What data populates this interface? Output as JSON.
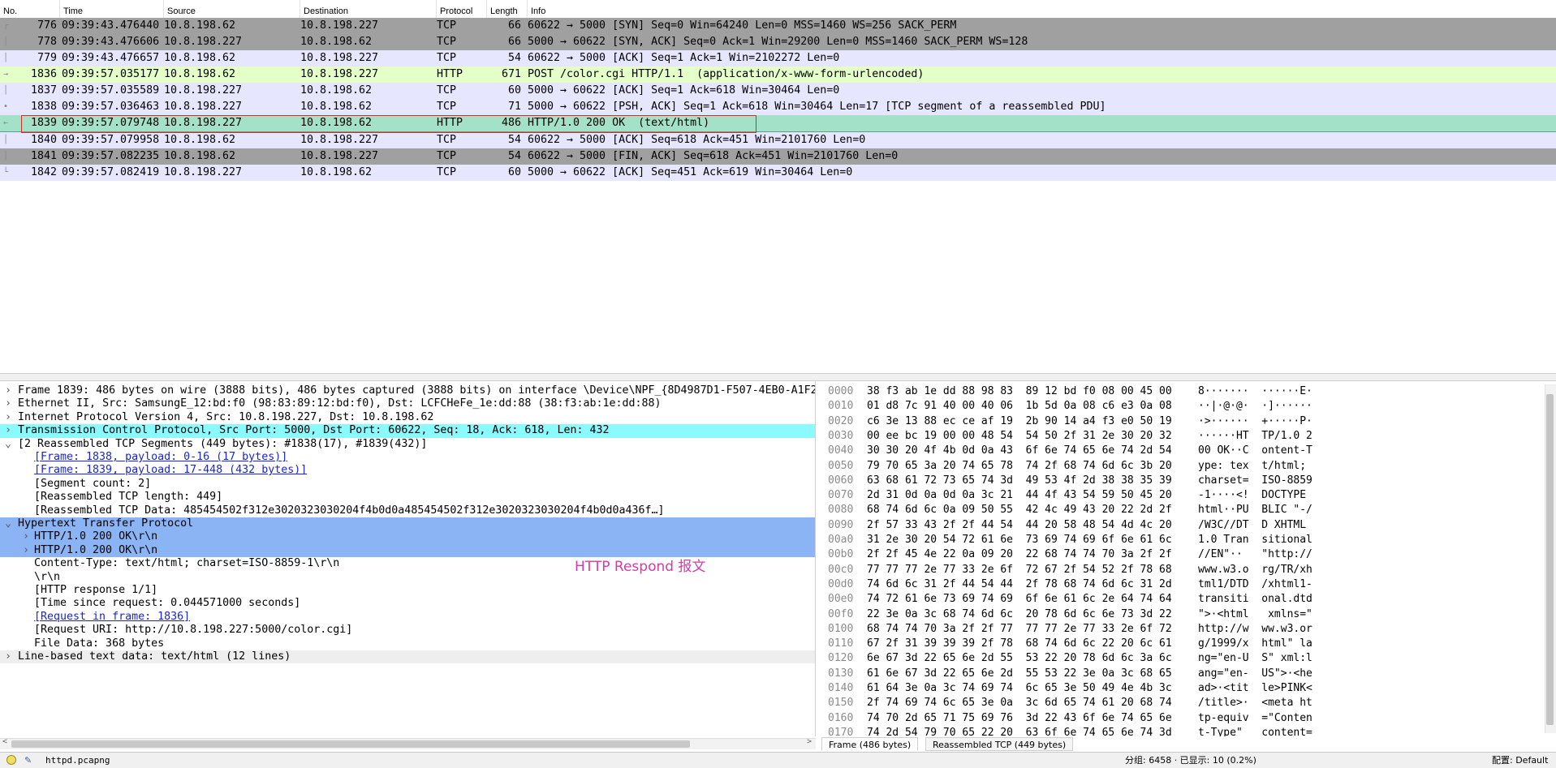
{
  "packet_list": {
    "columns": [
      "No.",
      "Time",
      "Source",
      "Destination",
      "Protocol",
      "Length",
      "Info"
    ],
    "rows": [
      {
        "no": "776",
        "time": "09:39:43.476440",
        "src": "10.8.198.62",
        "dst": "10.8.198.227",
        "proto": "TCP",
        "len": "66",
        "info": "60622 → 5000 [SYN] Seq=0 Win=64240 Len=0 MSS=1460 WS=256 SACK_PERM",
        "bg": "#a0a0a0",
        "rel": "┌"
      },
      {
        "no": "778",
        "time": "09:39:43.476606",
        "src": "10.8.198.227",
        "dst": "10.8.198.62",
        "proto": "TCP",
        "len": "66",
        "info": "5000 → 60622 [SYN, ACK] Seq=0 Ack=1 Win=29200 Len=0 MSS=1460 SACK_PERM WS=128",
        "bg": "#a0a0a0",
        "rel": "│"
      },
      {
        "no": "779",
        "time": "09:39:43.476657",
        "src": "10.8.198.62",
        "dst": "10.8.198.227",
        "proto": "TCP",
        "len": "54",
        "info": "60622 → 5000 [ACK] Seq=1 Ack=1 Win=2102272 Len=0",
        "bg": "#e7e6ff",
        "rel": "│"
      },
      {
        "no": "1836",
        "time": "09:39:57.035177",
        "src": "10.8.198.62",
        "dst": "10.8.198.227",
        "proto": "HTTP",
        "len": "671",
        "info": "POST /color.cgi HTTP/1.1  (application/x-www-form-urlencoded)",
        "bg": "#e4ffc7",
        "rel": "→"
      },
      {
        "no": "1837",
        "time": "09:39:57.035589",
        "src": "10.8.198.227",
        "dst": "10.8.198.62",
        "proto": "TCP",
        "len": "60",
        "info": "5000 → 60622 [ACK] Seq=1 Ack=618 Win=30464 Len=0",
        "bg": "#e7e6ff",
        "rel": "│"
      },
      {
        "no": "1838",
        "time": "09:39:57.036463",
        "src": "10.8.198.227",
        "dst": "10.8.198.62",
        "proto": "TCP",
        "len": "71",
        "info": "5000 → 60622 [PSH, ACK] Seq=1 Ack=618 Win=30464 Len=17 [TCP segment of a reassembled PDU]",
        "bg": "#e7e6ff",
        "rel": "•"
      },
      {
        "no": "1839",
        "time": "09:39:57.079748",
        "src": "10.8.198.227",
        "dst": "10.8.198.62",
        "proto": "HTTP",
        "len": "486",
        "info": "HTTP/1.0 200 OK  (text/html)",
        "bg": "#a3e1c8",
        "rel": "←"
      },
      {
        "no": "1840",
        "time": "09:39:57.079958",
        "src": "10.8.198.62",
        "dst": "10.8.198.227",
        "proto": "TCP",
        "len": "54",
        "info": "60622 → 5000 [ACK] Seq=618 Ack=451 Win=2101760 Len=0",
        "bg": "#e7e6ff",
        "rel": "│"
      },
      {
        "no": "1841",
        "time": "09:39:57.082235",
        "src": "10.8.198.62",
        "dst": "10.8.198.227",
        "proto": "TCP",
        "len": "54",
        "info": "60622 → 5000 [FIN, ACK] Seq=618 Ack=451 Win=2101760 Len=0",
        "bg": "#a0a0a0",
        "rel": "│"
      },
      {
        "no": "1842",
        "time": "09:39:57.082419",
        "src": "10.8.198.227",
        "dst": "10.8.198.62",
        "proto": "TCP",
        "len": "60",
        "info": "5000 → 60622 [ACK] Seq=451 Ack=619 Win=30464 Len=0",
        "bg": "#e7e6ff",
        "rel": "└"
      }
    ]
  },
  "details": {
    "rows": [
      {
        "text": "Frame 1839: 486 bytes on wire (3888 bits), 486 bytes captured (3888 bits) on interface \\Device\\NPF_{8D4987D1-F507-4EB0-A1F2",
        "indent": 0,
        "tri": ">",
        "bg": "",
        "link": false
      },
      {
        "text": "Ethernet II, Src: SamsungE_12:bd:f0 (98:83:89:12:bd:f0), Dst: LCFCHeFe_1e:dd:88 (38:f3:ab:1e:dd:88)",
        "indent": 0,
        "tri": ">",
        "bg": "",
        "link": false
      },
      {
        "text": "Internet Protocol Version 4, Src: 10.8.198.227, Dst: 10.8.198.62",
        "indent": 0,
        "tri": ">",
        "bg": "",
        "link": false
      },
      {
        "text": "Transmission Control Protocol, Src Port: 5000, Dst Port: 60622, Seq: 18, Ack: 618, Len: 432",
        "indent": 0,
        "tri": ">",
        "bg": "#8afaff",
        "link": false
      },
      {
        "text": "[2 Reassembled TCP Segments (449 bytes): #1838(17), #1839(432)]",
        "indent": 0,
        "tri": "v",
        "bg": "",
        "link": false
      },
      {
        "text": "[Frame: 1838, payload: 0-16 (17 bytes)]",
        "indent": 2,
        "tri": "",
        "bg": "",
        "link": true
      },
      {
        "text": "[Frame: 1839, payload: 17-448 (432 bytes)]",
        "indent": 2,
        "tri": "",
        "bg": "",
        "link": true
      },
      {
        "text": "[Segment count: 2]",
        "indent": 2,
        "tri": "",
        "bg": "",
        "link": false
      },
      {
        "text": "[Reassembled TCP length: 449]",
        "indent": 2,
        "tri": "",
        "bg": "",
        "link": false
      },
      {
        "text": "[Reassembled TCP Data: 485454502f312e3020323030204f4b0d0a485454502f312e3020323030204f4b0d0a436f…]",
        "indent": 2,
        "tri": "",
        "bg": "",
        "link": false
      },
      {
        "text": "Hypertext Transfer Protocol",
        "indent": 0,
        "tri": "v",
        "bg": "#8bb4f5",
        "link": false
      },
      {
        "text": "HTTP/1.0 200 OK\\r\\n",
        "indent": 2,
        "tri": ">",
        "bg": "#8bb4f5",
        "link": false
      },
      {
        "text": "HTTP/1.0 200 OK\\r\\n",
        "indent": 2,
        "tri": ">",
        "bg": "#8bb4f5",
        "link": false
      },
      {
        "text": "Content-Type: text/html; charset=ISO-8859-1\\r\\n",
        "indent": 2,
        "tri": "",
        "bg": "",
        "link": false
      },
      {
        "text": "\\r\\n",
        "indent": 2,
        "tri": "",
        "bg": "",
        "link": false
      },
      {
        "text": "[HTTP response 1/1]",
        "indent": 2,
        "tri": "",
        "bg": "",
        "link": false
      },
      {
        "text": "[Time since request: 0.044571000 seconds]",
        "indent": 2,
        "tri": "",
        "bg": "",
        "link": false
      },
      {
        "text": "[Request in frame: 1836]",
        "indent": 2,
        "tri": "",
        "bg": "",
        "link": true
      },
      {
        "text": "[Request URI: http://10.8.198.227:5000/color.cgi]",
        "indent": 2,
        "tri": "",
        "bg": "",
        "link": false
      },
      {
        "text": "File Data: 368 bytes",
        "indent": 2,
        "tri": "",
        "bg": "",
        "link": false
      },
      {
        "text": "Line-based text data: text/html (12 lines)",
        "indent": 0,
        "tri": ">",
        "bg": "#eeeeee",
        "link": false
      }
    ],
    "annotation": "HTTP Respond 报文"
  },
  "hex": {
    "rows": [
      {
        "off": "0000",
        "bytes": "38 f3 ab 1e dd 88 98 83  89 12 bd f0 08 00 45 00",
        "ascii": "8·······  ······E·"
      },
      {
        "off": "0010",
        "bytes": "01 d8 7c 91 40 00 40 06  1b 5d 0a 08 c6 e3 0a 08",
        "ascii": "··|·@·@·  ·]······"
      },
      {
        "off": "0020",
        "bytes": "c6 3e 13 88 ec ce af 19  2b 90 14 a4 f3 e0 50 19",
        "ascii": "·>······  +·····P·"
      },
      {
        "off": "0030",
        "bytes": "00 ee bc 19 00 00 48 54  54 50 2f 31 2e 30 20 32",
        "ascii": "······HT  TP/1.0 2"
      },
      {
        "off": "0040",
        "bytes": "30 30 20 4f 4b 0d 0a 43  6f 6e 74 65 6e 74 2d 54",
        "ascii": "00 OK··C  ontent-T"
      },
      {
        "off": "0050",
        "bytes": "79 70 65 3a 20 74 65 78  74 2f 68 74 6d 6c 3b 20",
        "ascii": "ype: tex  t/html; "
      },
      {
        "off": "0060",
        "bytes": "63 68 61 72 73 65 74 3d  49 53 4f 2d 38 38 35 39",
        "ascii": "charset=  ISO-8859"
      },
      {
        "off": "0070",
        "bytes": "2d 31 0d 0a 0d 0a 3c 21  44 4f 43 54 59 50 45 20",
        "ascii": "-1····<!  DOCTYPE "
      },
      {
        "off": "0080",
        "bytes": "68 74 6d 6c 0a 09 50 55  42 4c 49 43 20 22 2d 2f",
        "ascii": "html··PU  BLIC \"-/"
      },
      {
        "off": "0090",
        "bytes": "2f 57 33 43 2f 2f 44 54  44 20 58 48 54 4d 4c 20",
        "ascii": "/W3C//DT  D XHTML "
      },
      {
        "off": "00a0",
        "bytes": "31 2e 30 20 54 72 61 6e  73 69 74 69 6f 6e 61 6c",
        "ascii": "1.0 Tran  sitional"
      },
      {
        "off": "00b0",
        "bytes": "2f 2f 45 4e 22 0a 09 20  22 68 74 74 70 3a 2f 2f",
        "ascii": "//EN\"··   \"http://"
      },
      {
        "off": "00c0",
        "bytes": "77 77 77 2e 77 33 2e 6f  72 67 2f 54 52 2f 78 68",
        "ascii": "www.w3.o  rg/TR/xh"
      },
      {
        "off": "00d0",
        "bytes": "74 6d 6c 31 2f 44 54 44  2f 78 68 74 6d 6c 31 2d",
        "ascii": "tml1/DTD  /xhtml1-"
      },
      {
        "off": "00e0",
        "bytes": "74 72 61 6e 73 69 74 69  6f 6e 61 6c 2e 64 74 64",
        "ascii": "transiti  onal.dtd"
      },
      {
        "off": "00f0",
        "bytes": "22 3e 0a 3c 68 74 6d 6c  20 78 6d 6c 6e 73 3d 22",
        "ascii": "\">·<html   xmlns=\""
      },
      {
        "off": "0100",
        "bytes": "68 74 74 70 3a 2f 2f 77  77 77 2e 77 33 2e 6f 72",
        "ascii": "http://w  ww.w3.or"
      },
      {
        "off": "0110",
        "bytes": "67 2f 31 39 39 39 2f 78  68 74 6d 6c 22 20 6c 61",
        "ascii": "g/1999/x  html\" la"
      },
      {
        "off": "0120",
        "bytes": "6e 67 3d 22 65 6e 2d 55  53 22 20 78 6d 6c 3a 6c",
        "ascii": "ng=\"en-U  S\" xml:l"
      },
      {
        "off": "0130",
        "bytes": "61 6e 67 3d 22 65 6e 2d  55 53 22 3e 0a 3c 68 65",
        "ascii": "ang=\"en-  US\">·<he"
      },
      {
        "off": "0140",
        "bytes": "61 64 3e 0a 3c 74 69 74  6c 65 3e 50 49 4e 4b 3c",
        "ascii": "ad>·<tit  le>PINK<"
      },
      {
        "off": "0150",
        "bytes": "2f 74 69 74 6c 65 3e 0a  3c 6d 65 74 61 20 68 74",
        "ascii": "/title>·  <meta ht"
      },
      {
        "off": "0160",
        "bytes": "74 70 2d 65 71 75 69 76  3d 22 43 6f 6e 74 65 6e",
        "ascii": "tp-equiv  =\"Conten"
      },
      {
        "off": "0170",
        "bytes": "74 2d 54 79 70 65 22 20  63 6f 6e 74 65 6e 74 3d",
        "ascii": "t-Type\"   content="
      }
    ],
    "tabs": [
      "Frame (486 bytes)",
      "Reassembled TCP (449 bytes)"
    ]
  },
  "status": {
    "file": "httpd.pcapng",
    "packets": "分组: 6458 · 已显示: 10 (0.2%)",
    "profile": "配置: Default"
  }
}
